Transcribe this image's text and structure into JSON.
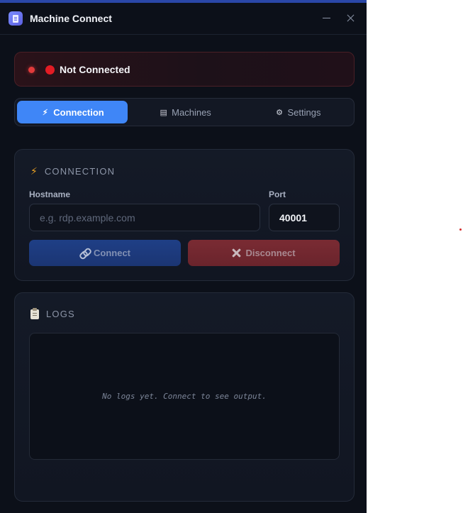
{
  "window": {
    "title": "Machine Connect",
    "minimize_icon": "minimize-icon",
    "close_icon": "close-icon"
  },
  "status": {
    "text": "Not Connected",
    "color": "#e31c24"
  },
  "tabs": [
    {
      "label": "Connection",
      "icon": "bolt-icon",
      "active": true
    },
    {
      "label": "Machines",
      "icon": "floppy-icon",
      "active": false
    },
    {
      "label": "Settings",
      "icon": "gear-icon",
      "active": false
    }
  ],
  "connection": {
    "heading": "CONNECTION",
    "hostname_label": "Hostname",
    "hostname_value": "",
    "hostname_placeholder": "e.g. rdp.example.com",
    "port_label": "Port",
    "port_value": "40001",
    "connect_label": "Connect",
    "disconnect_label": "Disconnect"
  },
  "logs": {
    "heading": "LOGS",
    "empty_text": "No logs yet. Connect to see output."
  },
  "colors": {
    "accent": "#3f86f7",
    "danger": "#e23b3b",
    "warning": "#f0a422"
  }
}
